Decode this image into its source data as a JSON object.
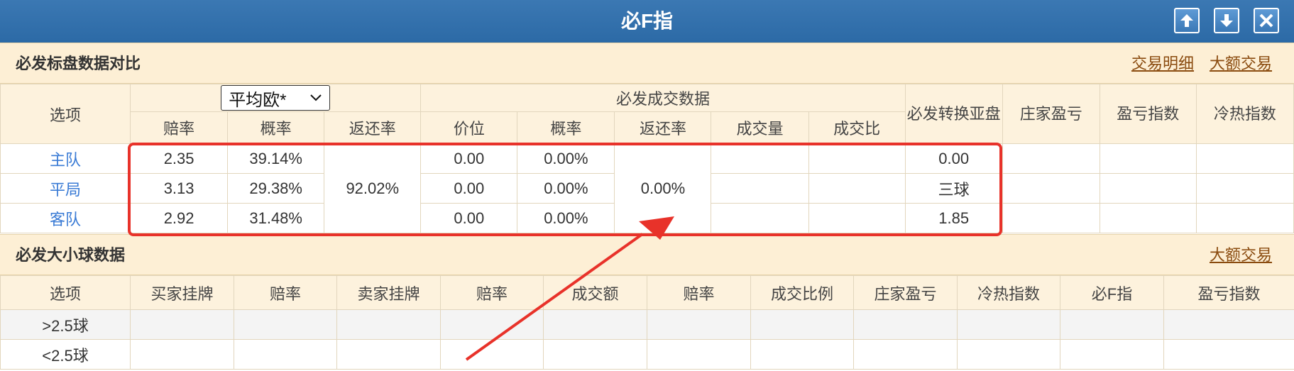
{
  "window": {
    "title": "必F指"
  },
  "section1": {
    "title": "必发标盘数据对比",
    "links": [
      "交易明细",
      "大额交易"
    ],
    "header": {
      "option": "选项",
      "select_value": "平均欧*",
      "trade_group": "必发成交数据",
      "convert": "必发转换亚盘",
      "banker_pl": "庄家盈亏",
      "pl_index": "盈亏指数",
      "hot_cold": "冷热指数",
      "sub": [
        "赔率",
        "概率",
        "返还率",
        "价位",
        "概率",
        "返还率",
        "成交量",
        "成交比"
      ]
    },
    "rows": [
      {
        "team": "主队",
        "odds": "2.35",
        "prob": "39.14%",
        "price": "0.00",
        "prob2": "0.00%",
        "asian": "0.00"
      },
      {
        "team": "平局",
        "odds": "3.13",
        "prob": "29.38%",
        "price": "0.00",
        "prob2": "0.00%",
        "asian": "三球"
      },
      {
        "team": "客队",
        "odds": "2.92",
        "prob": "31.48%",
        "price": "0.00",
        "prob2": "0.00%",
        "asian": "1.85"
      }
    ],
    "return_rate": "92.02%",
    "trade_return_rate": "0.00%"
  },
  "section2": {
    "title": "必发大小球数据",
    "link": "大额交易",
    "columns": [
      "选项",
      "买家挂牌",
      "赔率",
      "卖家挂牌",
      "赔率",
      "成交额",
      "赔率",
      "成交比例",
      "庄家盈亏",
      "冷热指数",
      "必F指",
      "盈亏指数"
    ],
    "rows": [
      {
        "option": ">2.5球"
      },
      {
        "option": "<2.5球"
      }
    ]
  },
  "colors": {
    "titlebar": "#2c6aa6",
    "section_bg": "#fdefd5",
    "link": "#8a4b0f",
    "team": "#3a7bd5",
    "annotation": "#e8322a"
  }
}
